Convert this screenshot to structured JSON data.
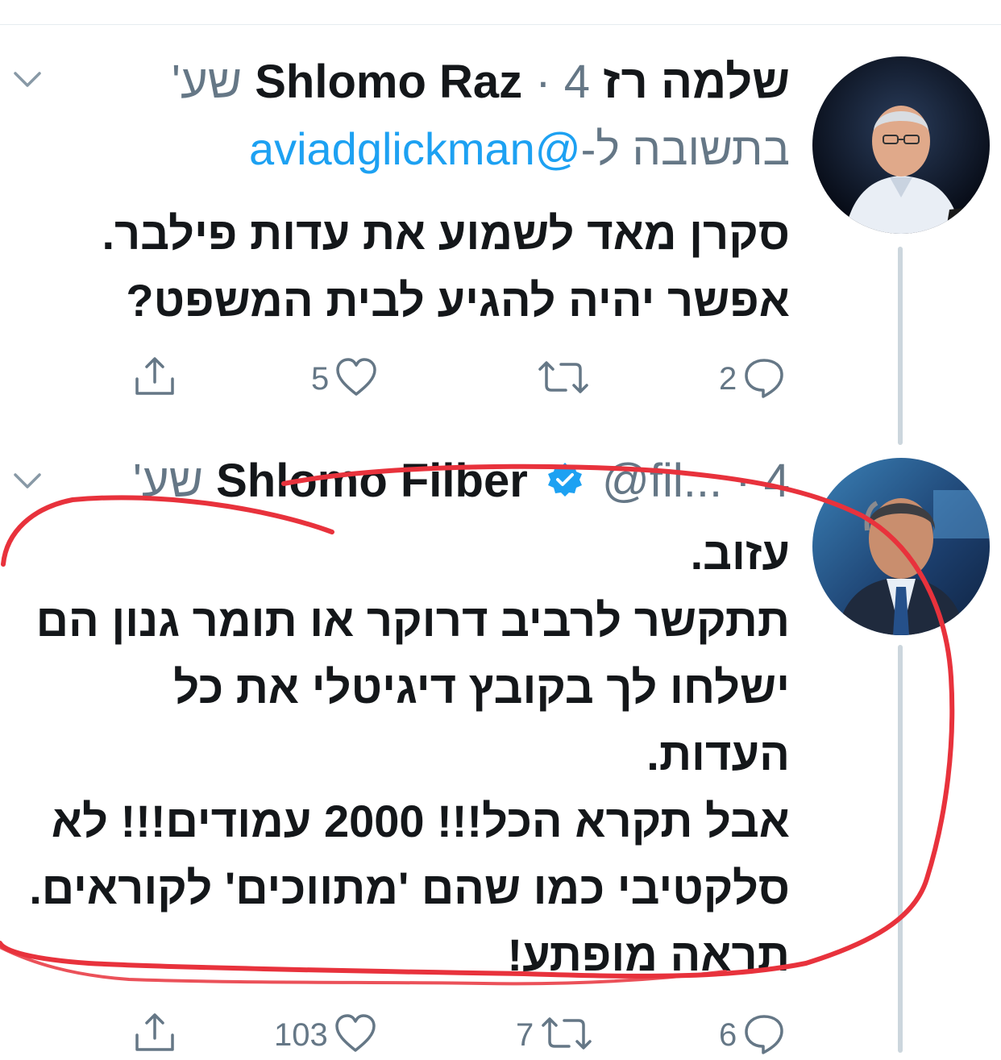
{
  "tweets": [
    {
      "display_name": "שלמה רז Shlomo Raz",
      "separator": "·",
      "time": "4 שע'",
      "reply_prefix": "בתשובה ל-",
      "reply_handle": "@aviadglickman",
      "body_lines": [
        "סקרן מאד לשמוע את עדות פילבר.",
        "אפשר יהיה להגיע לבית המשפט?"
      ],
      "actions": {
        "comments": "2",
        "retweets": "",
        "likes": "5"
      }
    },
    {
      "display_name": "Shlomo Filber",
      "handle": "@fil...",
      "separator": "·",
      "time": "4 שע'",
      "verified": true,
      "body_lines": [
        "עזוב.",
        "תתקשר לרביב דרוקר או תומר גנון הם",
        "ישלחו לך בקובץ דיגיטלי את כל",
        "העדות.",
        "אבל תקרא הכל!!! 2000 עמודים!!! לא",
        "סלקטיבי כמו שהם 'מתווכים' לקוראים.",
        "תראה מופתע!"
      ],
      "actions": {
        "comments": "6",
        "retweets": "7",
        "likes": "103"
      }
    }
  ],
  "colors": {
    "mention": "#1da1f2",
    "secondary": "#657786",
    "annotation": "#e8323c",
    "verified": "#1da1f2"
  },
  "icons": [
    "chevron-down-icon",
    "comment-icon",
    "retweet-icon",
    "like-icon",
    "share-icon",
    "verified-icon"
  ]
}
